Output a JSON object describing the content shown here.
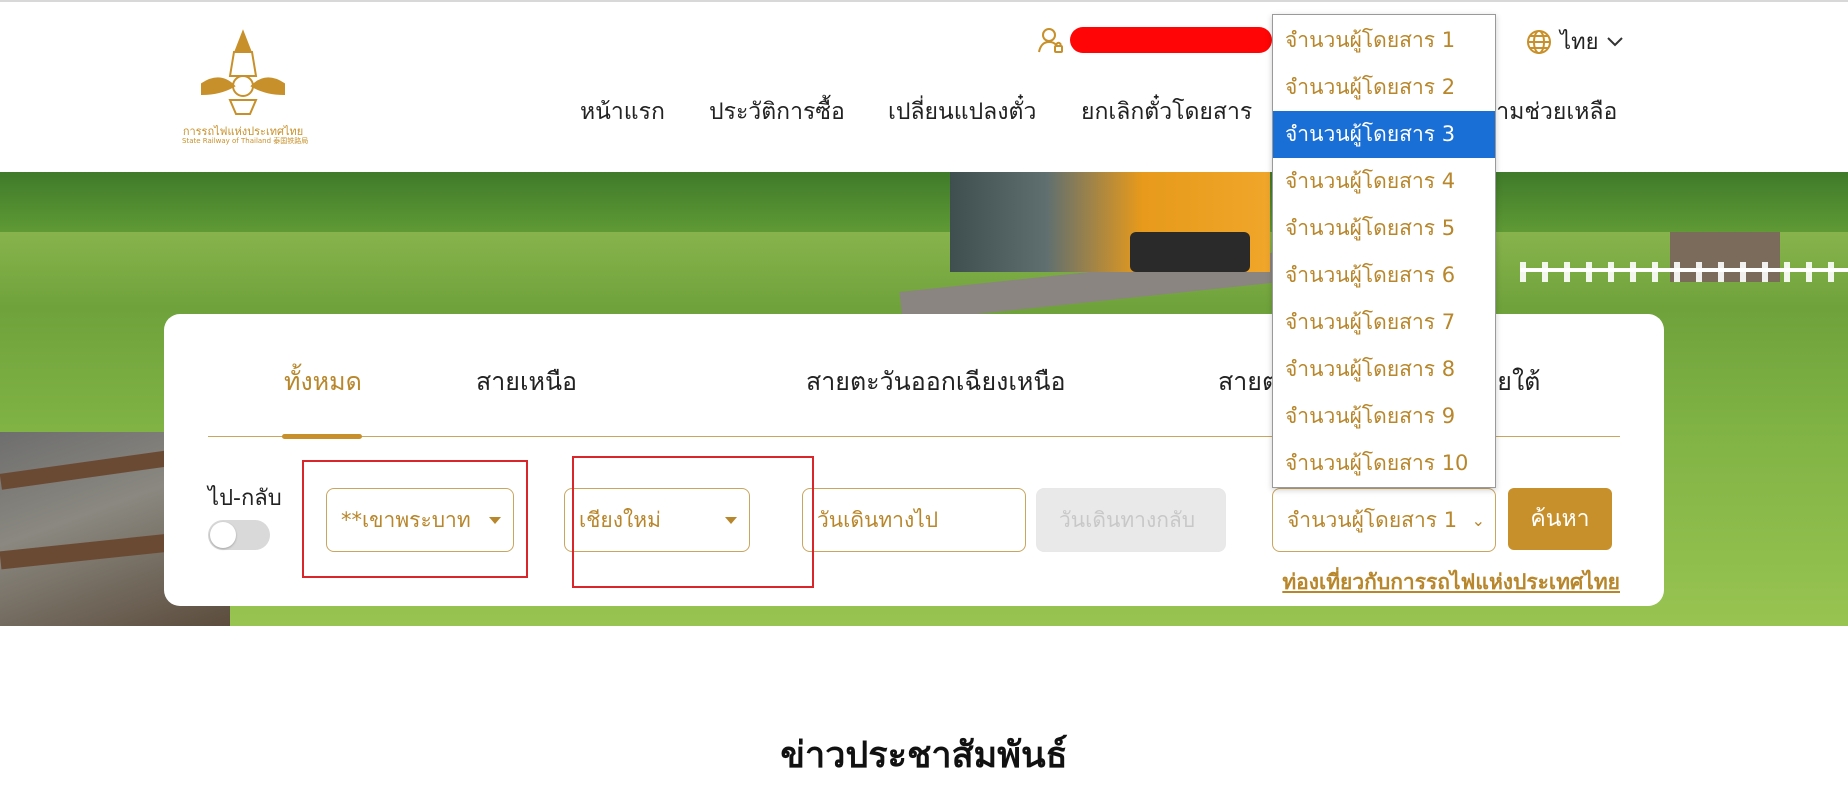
{
  "colors": {
    "brand_gold": "#c8902a",
    "selected_option": "#1a6fd6",
    "highlight_box": "#d9262a",
    "redaction": "#ff0505"
  },
  "logo": {
    "text_th": "การรถไฟแห่งประเทศไทย",
    "text_en": "State Railway of Thailand 泰国铁路局"
  },
  "header": {
    "user_icon": "user-icon",
    "language": {
      "icon": "globe-icon",
      "label": "ไทย",
      "chevron": "chevron-down-icon"
    }
  },
  "nav": {
    "items": [
      "หน้าแรก",
      "ประวัติการซื้อ",
      "เปลี่ยนแปลงตั๋ว",
      "ยกเลิกตั๋วโดยสาร",
      "ความช่วยเหลือ"
    ]
  },
  "booking": {
    "tabs": [
      "ทั้งหมด",
      "สายเหนือ",
      "สายตะวันออกเฉียงเหนือ",
      "สายตะวันออก",
      "สายใต้"
    ],
    "active_tab": 0,
    "round_trip_label": "ไป-กลับ",
    "round_trip_on": false,
    "origin_value": "**เขาพระบาท",
    "destination_value": "เชียงใหม่",
    "depart_date_placeholder": "วันเดินทางไป",
    "return_date_placeholder": "วันเดินทางกลับ",
    "passengers_value": "จำนวนผู้โดยสาร 1",
    "search_label": "ค้นหา",
    "tourism_link": "ท่องเที่ยวกับการรถไฟแห่งประเทศไทย"
  },
  "passenger_dropdown": {
    "options": [
      "จำนวนผู้โดยสาร 1",
      "จำนวนผู้โดยสาร 2",
      "จำนวนผู้โดยสาร 3",
      "จำนวนผู้โดยสาร 4",
      "จำนวนผู้โดยสาร 5",
      "จำนวนผู้โดยสาร 6",
      "จำนวนผู้โดยสาร 7",
      "จำนวนผู้โดยสาร 8",
      "จำนวนผู้โดยสาร 9",
      "จำนวนผู้โดยสาร 10"
    ],
    "selected_index": 2
  },
  "news": {
    "title": "ข่าวประชาสัมพันธ์"
  }
}
